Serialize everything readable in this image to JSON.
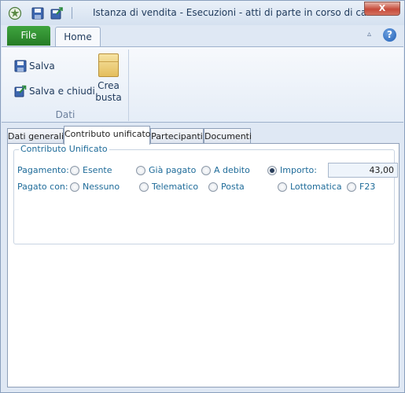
{
  "window": {
    "title": "Istanza di vendita - Esecuzioni - atti di parte in corso di causa",
    "close_label": "X"
  },
  "quick_access": {
    "icons": [
      "emblem-icon",
      "save-icon",
      "save-close-icon"
    ]
  },
  "ribbon": {
    "file_tab": "File",
    "home_tab": "Home",
    "help_label": "?",
    "minimize_label": "▵",
    "salva_label": "Salva",
    "salva_chiudi_label": "Salva e chiudi",
    "crea_busta_line1": "Crea",
    "crea_busta_line2": "busta",
    "group_label": "Dati"
  },
  "tabs": [
    {
      "label": "Dati generali",
      "active": false
    },
    {
      "label": "Contributo unificato",
      "active": true
    },
    {
      "label": "Partecipanti",
      "active": false
    },
    {
      "label": "Documenti",
      "active": false
    }
  ],
  "contributo": {
    "legend": "Contributo Unificato",
    "pagamento_label": "Pagamento:",
    "pagamento_options": [
      {
        "label": "Esente",
        "checked": false
      },
      {
        "label": "Già pagato",
        "checked": false
      },
      {
        "label": "A debito",
        "checked": false
      },
      {
        "label": "Importo:",
        "checked": true
      }
    ],
    "importo_value": "43,00",
    "pagato_con_label": "Pagato con:",
    "pagato_con_options": [
      {
        "label": "Nessuno",
        "checked": false
      },
      {
        "label": "Telematico",
        "checked": false
      },
      {
        "label": "Posta",
        "checked": false
      },
      {
        "label": "Lottomatica",
        "checked": false
      },
      {
        "label": "F23",
        "checked": false
      }
    ]
  },
  "colors": {
    "accent": "#1e6b99",
    "file_tab": "#2f8f2f",
    "close_button": "#c64a3a"
  }
}
